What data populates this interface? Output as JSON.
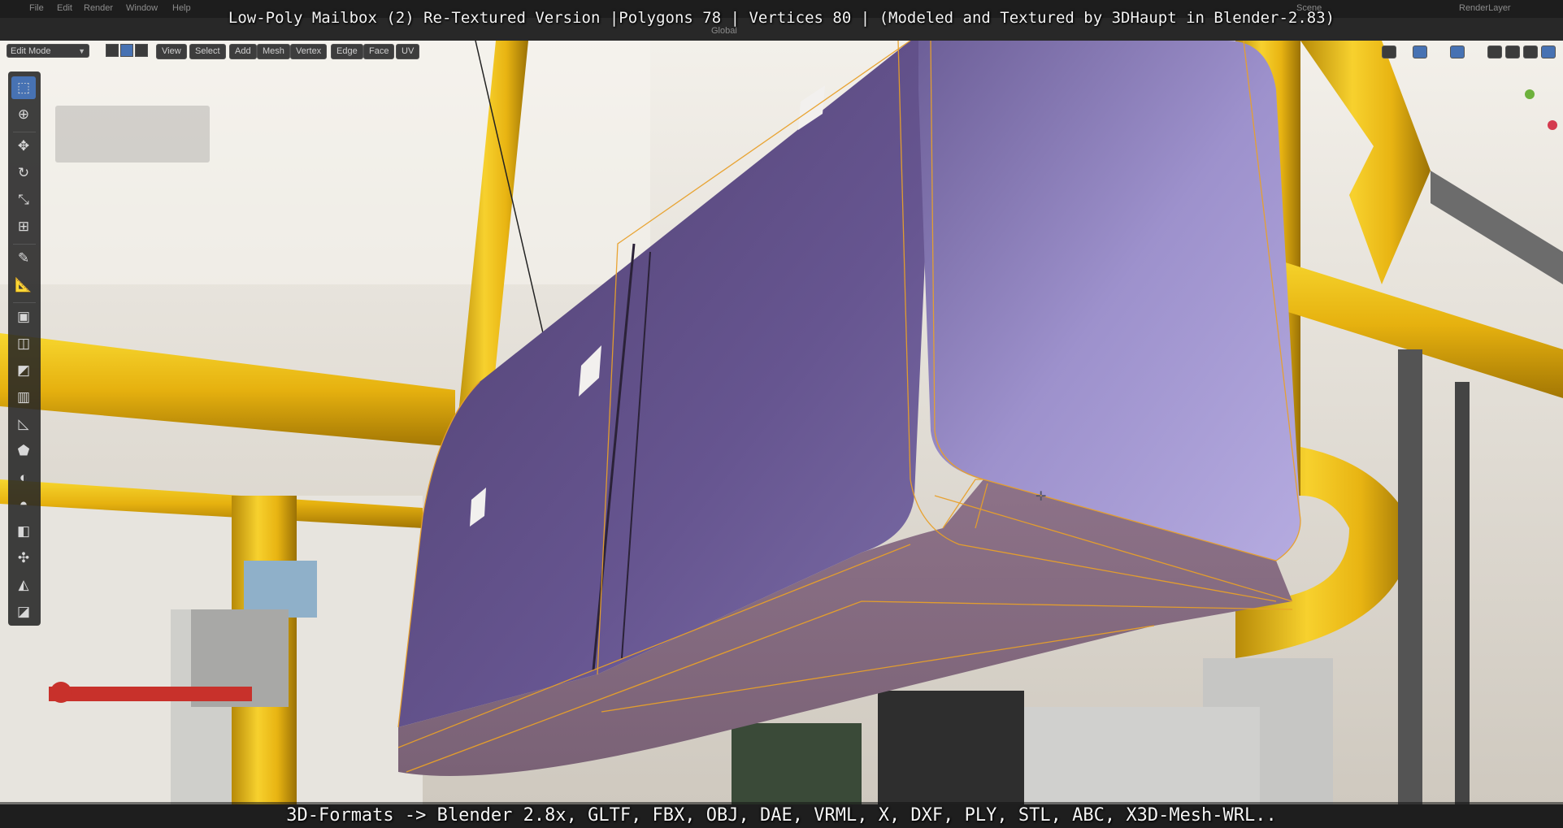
{
  "video": {
    "title": "Low-Poly Mailbox (2) Re-Textured Version |Polygons 78 | Vertices 80 | (Modeled and Textured by 3DHaupt in Blender-2.83)",
    "caption": "3D-Formats -> Blender 2.8x, GLTF, FBX, OBJ, DAE, VRML, X, DXF, PLY, STL, ABC, X3D-Mesh-WRL.."
  },
  "app_menu": [
    {
      "label": "File"
    },
    {
      "label": "Edit"
    },
    {
      "label": "Render"
    },
    {
      "label": "Window"
    },
    {
      "label": "Help"
    }
  ],
  "workspace_right": {
    "scene": "Scene",
    "render_layer": "RenderLayer"
  },
  "viewport_header": {
    "mode": "Edit Mode",
    "menus": [
      "View",
      "Select",
      "Add",
      "Mesh",
      "Vertex",
      "Edge",
      "Face",
      "UV"
    ],
    "orientation": "Global"
  },
  "toolbar": {
    "tools": [
      {
        "name": "select-box",
        "icon": "select-box-icon",
        "glyph": "⬚",
        "active": true
      },
      {
        "name": "cursor",
        "icon": "cursor-icon",
        "glyph": "⊕",
        "active": false
      },
      {
        "name": "move",
        "icon": "move-icon",
        "glyph": "✥",
        "active": false
      },
      {
        "name": "rotate",
        "icon": "rotate-icon",
        "glyph": "↻",
        "active": false
      },
      {
        "name": "scale",
        "icon": "scale-icon",
        "glyph": "⤡",
        "active": false
      },
      {
        "name": "transform",
        "icon": "transform-icon",
        "glyph": "⊞",
        "active": false
      },
      {
        "name": "annotate",
        "icon": "annotate-icon",
        "glyph": "✎",
        "active": false
      },
      {
        "name": "measure",
        "icon": "measure-icon",
        "glyph": "📐",
        "active": false
      },
      {
        "name": "extrude",
        "icon": "extrude-icon",
        "glyph": "▣",
        "active": false
      },
      {
        "name": "inset",
        "icon": "inset-icon",
        "glyph": "◫",
        "active": false
      },
      {
        "name": "bevel",
        "icon": "bevel-icon",
        "glyph": "◩",
        "active": false
      },
      {
        "name": "loop-cut",
        "icon": "loop-cut-icon",
        "glyph": "▥",
        "active": false
      },
      {
        "name": "knife",
        "icon": "knife-icon",
        "glyph": "◺",
        "active": false
      },
      {
        "name": "poly-build",
        "icon": "poly-build-icon",
        "glyph": "⬟",
        "active": false
      },
      {
        "name": "spin",
        "icon": "spin-icon",
        "glyph": "◐",
        "active": false
      },
      {
        "name": "smooth",
        "icon": "smooth-icon",
        "glyph": "◓",
        "active": false
      },
      {
        "name": "edge-slide",
        "icon": "edge-slide-icon",
        "glyph": "◧",
        "active": false
      },
      {
        "name": "shrink-fatten",
        "icon": "shrink-fatten-icon",
        "glyph": "✣",
        "active": false
      },
      {
        "name": "shear",
        "icon": "shear-icon",
        "glyph": "◭",
        "active": false
      },
      {
        "name": "rip-region",
        "icon": "rip-region-icon",
        "glyph": "◪",
        "active": false
      }
    ]
  },
  "colors": {
    "edit_wire": "#e8a02a",
    "mailbox_body": "#5d4a7a",
    "mailbox_highlight": "#a79ad6",
    "pipe_yellow": "#f2c319",
    "active_tool": "#4772b3"
  }
}
